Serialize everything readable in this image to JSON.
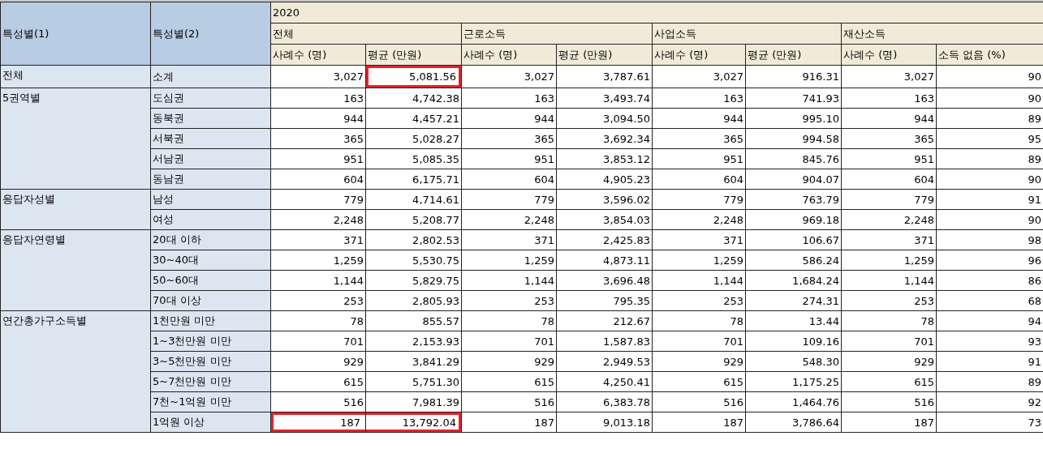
{
  "header": {
    "col1": "특성별(1)",
    "col2": "특성별(2)",
    "year": "2020",
    "sections": [
      {
        "label": "전체",
        "columns": [
          "사례수 (명)",
          "평균 (만원)"
        ]
      },
      {
        "label": "근로소득",
        "columns": [
          "사례수 (명)",
          "평균 (만원)"
        ]
      },
      {
        "label": "사업소득",
        "columns": [
          "사례수 (명)",
          "평균 (만원)"
        ]
      },
      {
        "label": "재산소득",
        "columns": [
          "사례수 (명)",
          "소득 없음 (%)"
        ]
      }
    ]
  },
  "groups": [
    {
      "label": "전체",
      "rows": [
        {
          "label": "소계",
          "values": [
            "3,027",
            "5,081.56",
            "3,027",
            "3,787.61",
            "3,027",
            "916.31",
            "3,027",
            "90"
          ],
          "count_boxed": false,
          "average_boxed": true
        }
      ]
    },
    {
      "label": "5권역별",
      "rows": [
        {
          "label": "도심권",
          "values": [
            "163",
            "4,742.38",
            "163",
            "3,493.74",
            "163",
            "741.93",
            "163",
            "90"
          ],
          "count_boxed": false,
          "average_boxed": false
        },
        {
          "label": "동북권",
          "values": [
            "944",
            "4,457.21",
            "944",
            "3,094.50",
            "944",
            "995.10",
            "944",
            "89"
          ],
          "count_boxed": false,
          "average_boxed": false
        },
        {
          "label": "서북권",
          "values": [
            "365",
            "5,028.27",
            "365",
            "3,692.34",
            "365",
            "994.58",
            "365",
            "95"
          ],
          "count_boxed": false,
          "average_boxed": false
        },
        {
          "label": "서남권",
          "values": [
            "951",
            "5,085.35",
            "951",
            "3,853.12",
            "951",
            "845.76",
            "951",
            "89"
          ],
          "count_boxed": false,
          "average_boxed": false
        },
        {
          "label": "동남권",
          "values": [
            "604",
            "6,175.71",
            "604",
            "4,905.23",
            "604",
            "904.07",
            "604",
            "90"
          ],
          "count_boxed": false,
          "average_boxed": false
        }
      ]
    },
    {
      "label": "응답자성별",
      "rows": [
        {
          "label": "남성",
          "values": [
            "779",
            "4,714.61",
            "779",
            "3,596.02",
            "779",
            "763.79",
            "779",
            "91"
          ],
          "count_boxed": false,
          "average_boxed": false
        },
        {
          "label": "여성",
          "values": [
            "2,248",
            "5,208.77",
            "2,248",
            "3,854.03",
            "2,248",
            "969.18",
            "2,248",
            "90"
          ],
          "count_boxed": false,
          "average_boxed": false
        }
      ]
    },
    {
      "label": "응답자연령별",
      "rows": [
        {
          "label": "20대 이하",
          "values": [
            "371",
            "2,802.53",
            "371",
            "2,425.83",
            "371",
            "106.67",
            "371",
            "98"
          ],
          "count_boxed": false,
          "average_boxed": false
        },
        {
          "label": "30~40대",
          "values": [
            "1,259",
            "5,530.75",
            "1,259",
            "4,873.11",
            "1,259",
            "586.24",
            "1,259",
            "96"
          ],
          "count_boxed": false,
          "average_boxed": false
        },
        {
          "label": "50~60대",
          "values": [
            "1,144",
            "5,829.75",
            "1,144",
            "3,696.48",
            "1,144",
            "1,684.24",
            "1,144",
            "86"
          ],
          "count_boxed": false,
          "average_boxed": false
        },
        {
          "label": "70대 이상",
          "values": [
            "253",
            "2,805.93",
            "253",
            "795.35",
            "253",
            "274.31",
            "253",
            "68"
          ],
          "count_boxed": false,
          "average_boxed": false
        }
      ]
    },
    {
      "label": "연간총가구소득별",
      "rows": [
        {
          "label": "1천만원 미만",
          "values": [
            "78",
            "855.57",
            "78",
            "212.67",
            "78",
            "13.44",
            "78",
            "94"
          ],
          "count_boxed": false,
          "average_boxed": false
        },
        {
          "label": "1~3천만원 미만",
          "values": [
            "701",
            "2,153.93",
            "701",
            "1,587.83",
            "701",
            "109.16",
            "701",
            "93"
          ],
          "count_boxed": false,
          "average_boxed": false
        },
        {
          "label": "3~5천만원 미만",
          "values": [
            "929",
            "3,841.29",
            "929",
            "2,949.53",
            "929",
            "548.30",
            "929",
            "91"
          ],
          "count_boxed": false,
          "average_boxed": false
        },
        {
          "label": "5~7천만원 미만",
          "values": [
            "615",
            "5,751.30",
            "615",
            "4,250.41",
            "615",
            "1,175.25",
            "615",
            "89"
          ],
          "count_boxed": false,
          "average_boxed": false
        },
        {
          "label": "7천~1억원 미만",
          "values": [
            "516",
            "7,981.39",
            "516",
            "6,383.78",
            "516",
            "1,464.76",
            "516",
            "92"
          ],
          "count_boxed": false,
          "average_boxed": false
        },
        {
          "label": "1억원 이상",
          "values": [
            "187",
            "13,792.04",
            "187",
            "9,013.18",
            "187",
            "3,786.64",
            "187",
            "73"
          ],
          "count_boxed": true,
          "average_boxed": true
        }
      ]
    }
  ]
}
